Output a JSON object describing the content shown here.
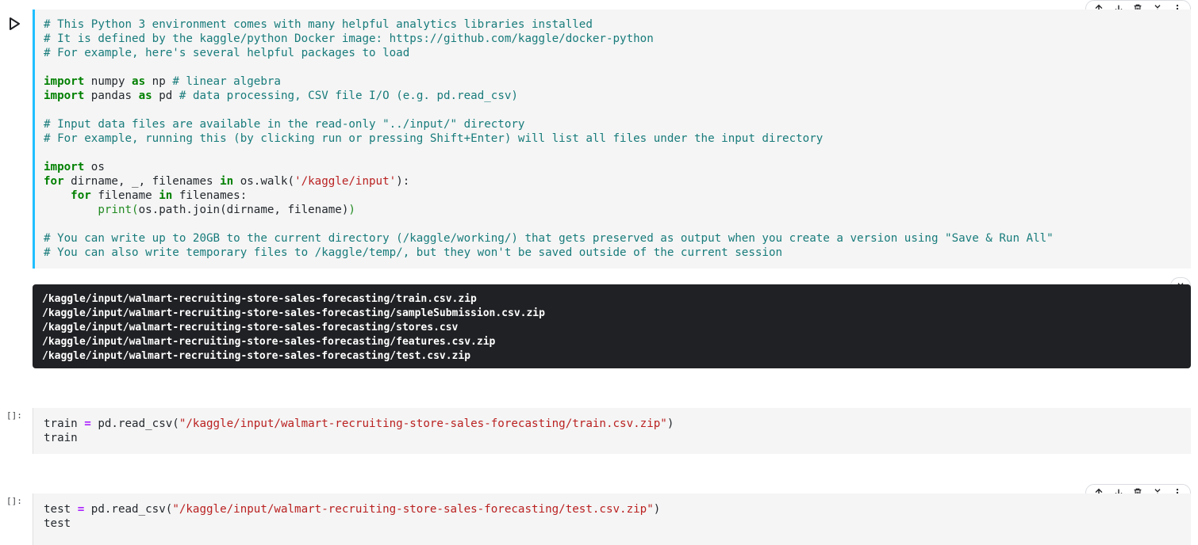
{
  "cells": [
    {
      "prompt": "",
      "lines": [
        [
          {
            "t": "cm",
            "v": "# This Python 3 environment comes with many helpful analytics libraries installed"
          }
        ],
        [
          {
            "t": "cm",
            "v": "# It is defined by the kaggle/python Docker image: https://github.com/kaggle/docker-python"
          }
        ],
        [
          {
            "t": "cm",
            "v": "# For example, here's several helpful packages to load"
          }
        ],
        [],
        [
          {
            "t": "kw",
            "v": "import"
          },
          {
            "t": "",
            "v": " numpy "
          },
          {
            "t": "kw",
            "v": "as"
          },
          {
            "t": "",
            "v": " np "
          },
          {
            "t": "cm",
            "v": "# linear algebra"
          }
        ],
        [
          {
            "t": "kw",
            "v": "import"
          },
          {
            "t": "",
            "v": " pandas "
          },
          {
            "t": "kw",
            "v": "as"
          },
          {
            "t": "",
            "v": " pd "
          },
          {
            "t": "cm",
            "v": "# data processing, CSV file I/O (e.g. pd.read_csv)"
          }
        ],
        [],
        [
          {
            "t": "cm",
            "v": "# Input data files are available in the read-only \"../input/\" directory"
          }
        ],
        [
          {
            "t": "cm",
            "v": "# For example, running this (by clicking run or pressing Shift+Enter) will list all files under the input directory"
          }
        ],
        [],
        [
          {
            "t": "kw",
            "v": "import"
          },
          {
            "t": "",
            "v": " os"
          }
        ],
        [
          {
            "t": "kw",
            "v": "for"
          },
          {
            "t": "",
            "v": " dirname, _, filenames "
          },
          {
            "t": "kw",
            "v": "in"
          },
          {
            "t": "",
            "v": " os.walk("
          },
          {
            "t": "st",
            "v": "'/kaggle/input'"
          },
          {
            "t": "",
            "v": "):"
          }
        ],
        [
          {
            "t": "",
            "v": "    "
          },
          {
            "t": "kw",
            "v": "for"
          },
          {
            "t": "",
            "v": " filename "
          },
          {
            "t": "kw",
            "v": "in"
          },
          {
            "t": "",
            "v": " filenames:"
          }
        ],
        [
          {
            "t": "",
            "v": "        "
          },
          {
            "t": "pa",
            "v": "print("
          },
          {
            "t": "",
            "v": "os.path.join(dirname, filename)"
          },
          {
            "t": "pa",
            "v": ")"
          }
        ],
        [],
        [
          {
            "t": "cm",
            "v": "# You can write up to 20GB to the current directory (/kaggle/working/) that gets preserved as output when you create a version using \"Save & Run All\""
          }
        ],
        [
          {
            "t": "cm",
            "v": "# You can also write temporary files to /kaggle/temp/, but they won't be saved outside of the current session"
          }
        ]
      ]
    },
    {
      "prompt": "[]:",
      "lines": [
        [
          {
            "t": "",
            "v": "train "
          },
          {
            "t": "op",
            "v": "="
          },
          {
            "t": "",
            "v": " pd.read_csv("
          },
          {
            "t": "st",
            "v": "\"/kaggle/input/walmart-recruiting-store-sales-forecasting/train.csv.zip\""
          },
          {
            "t": "",
            "v": ")"
          }
        ],
        [
          {
            "t": "",
            "v": "train"
          }
        ]
      ]
    },
    {
      "prompt": "[]:",
      "lines": [
        [
          {
            "t": "",
            "v": "test "
          },
          {
            "t": "op",
            "v": "="
          },
          {
            "t": "",
            "v": " pd.read_csv("
          },
          {
            "t": "st",
            "v": "\"/kaggle/input/walmart-recruiting-store-sales-forecasting/test.csv.zip\""
          },
          {
            "t": "",
            "v": ")"
          }
        ],
        [
          {
            "t": "",
            "v": "test"
          }
        ]
      ]
    }
  ],
  "output_lines": [
    "/kaggle/input/walmart-recruiting-store-sales-forecasting/train.csv.zip",
    "/kaggle/input/walmart-recruiting-store-sales-forecasting/sampleSubmission.csv.zip",
    "/kaggle/input/walmart-recruiting-store-sales-forecasting/stores.csv",
    "/kaggle/input/walmart-recruiting-store-sales-forecasting/features.csv.zip",
    "/kaggle/input/walmart-recruiting-store-sales-forecasting/test.csv.zip"
  ],
  "prompts": {
    "cell2": "[]:",
    "cell3": "[]:"
  },
  "icons": {
    "run": "play-icon",
    "toolbar": [
      "arrow-up-icon",
      "arrow-down-icon",
      "trash-icon",
      "collapse-icon",
      "more-vert-icon"
    ]
  },
  "colors": {
    "accent": "#20beff",
    "comment": "#187b7b",
    "keyword": "#008000",
    "string": "#ba2121",
    "output_bg": "#202124"
  }
}
